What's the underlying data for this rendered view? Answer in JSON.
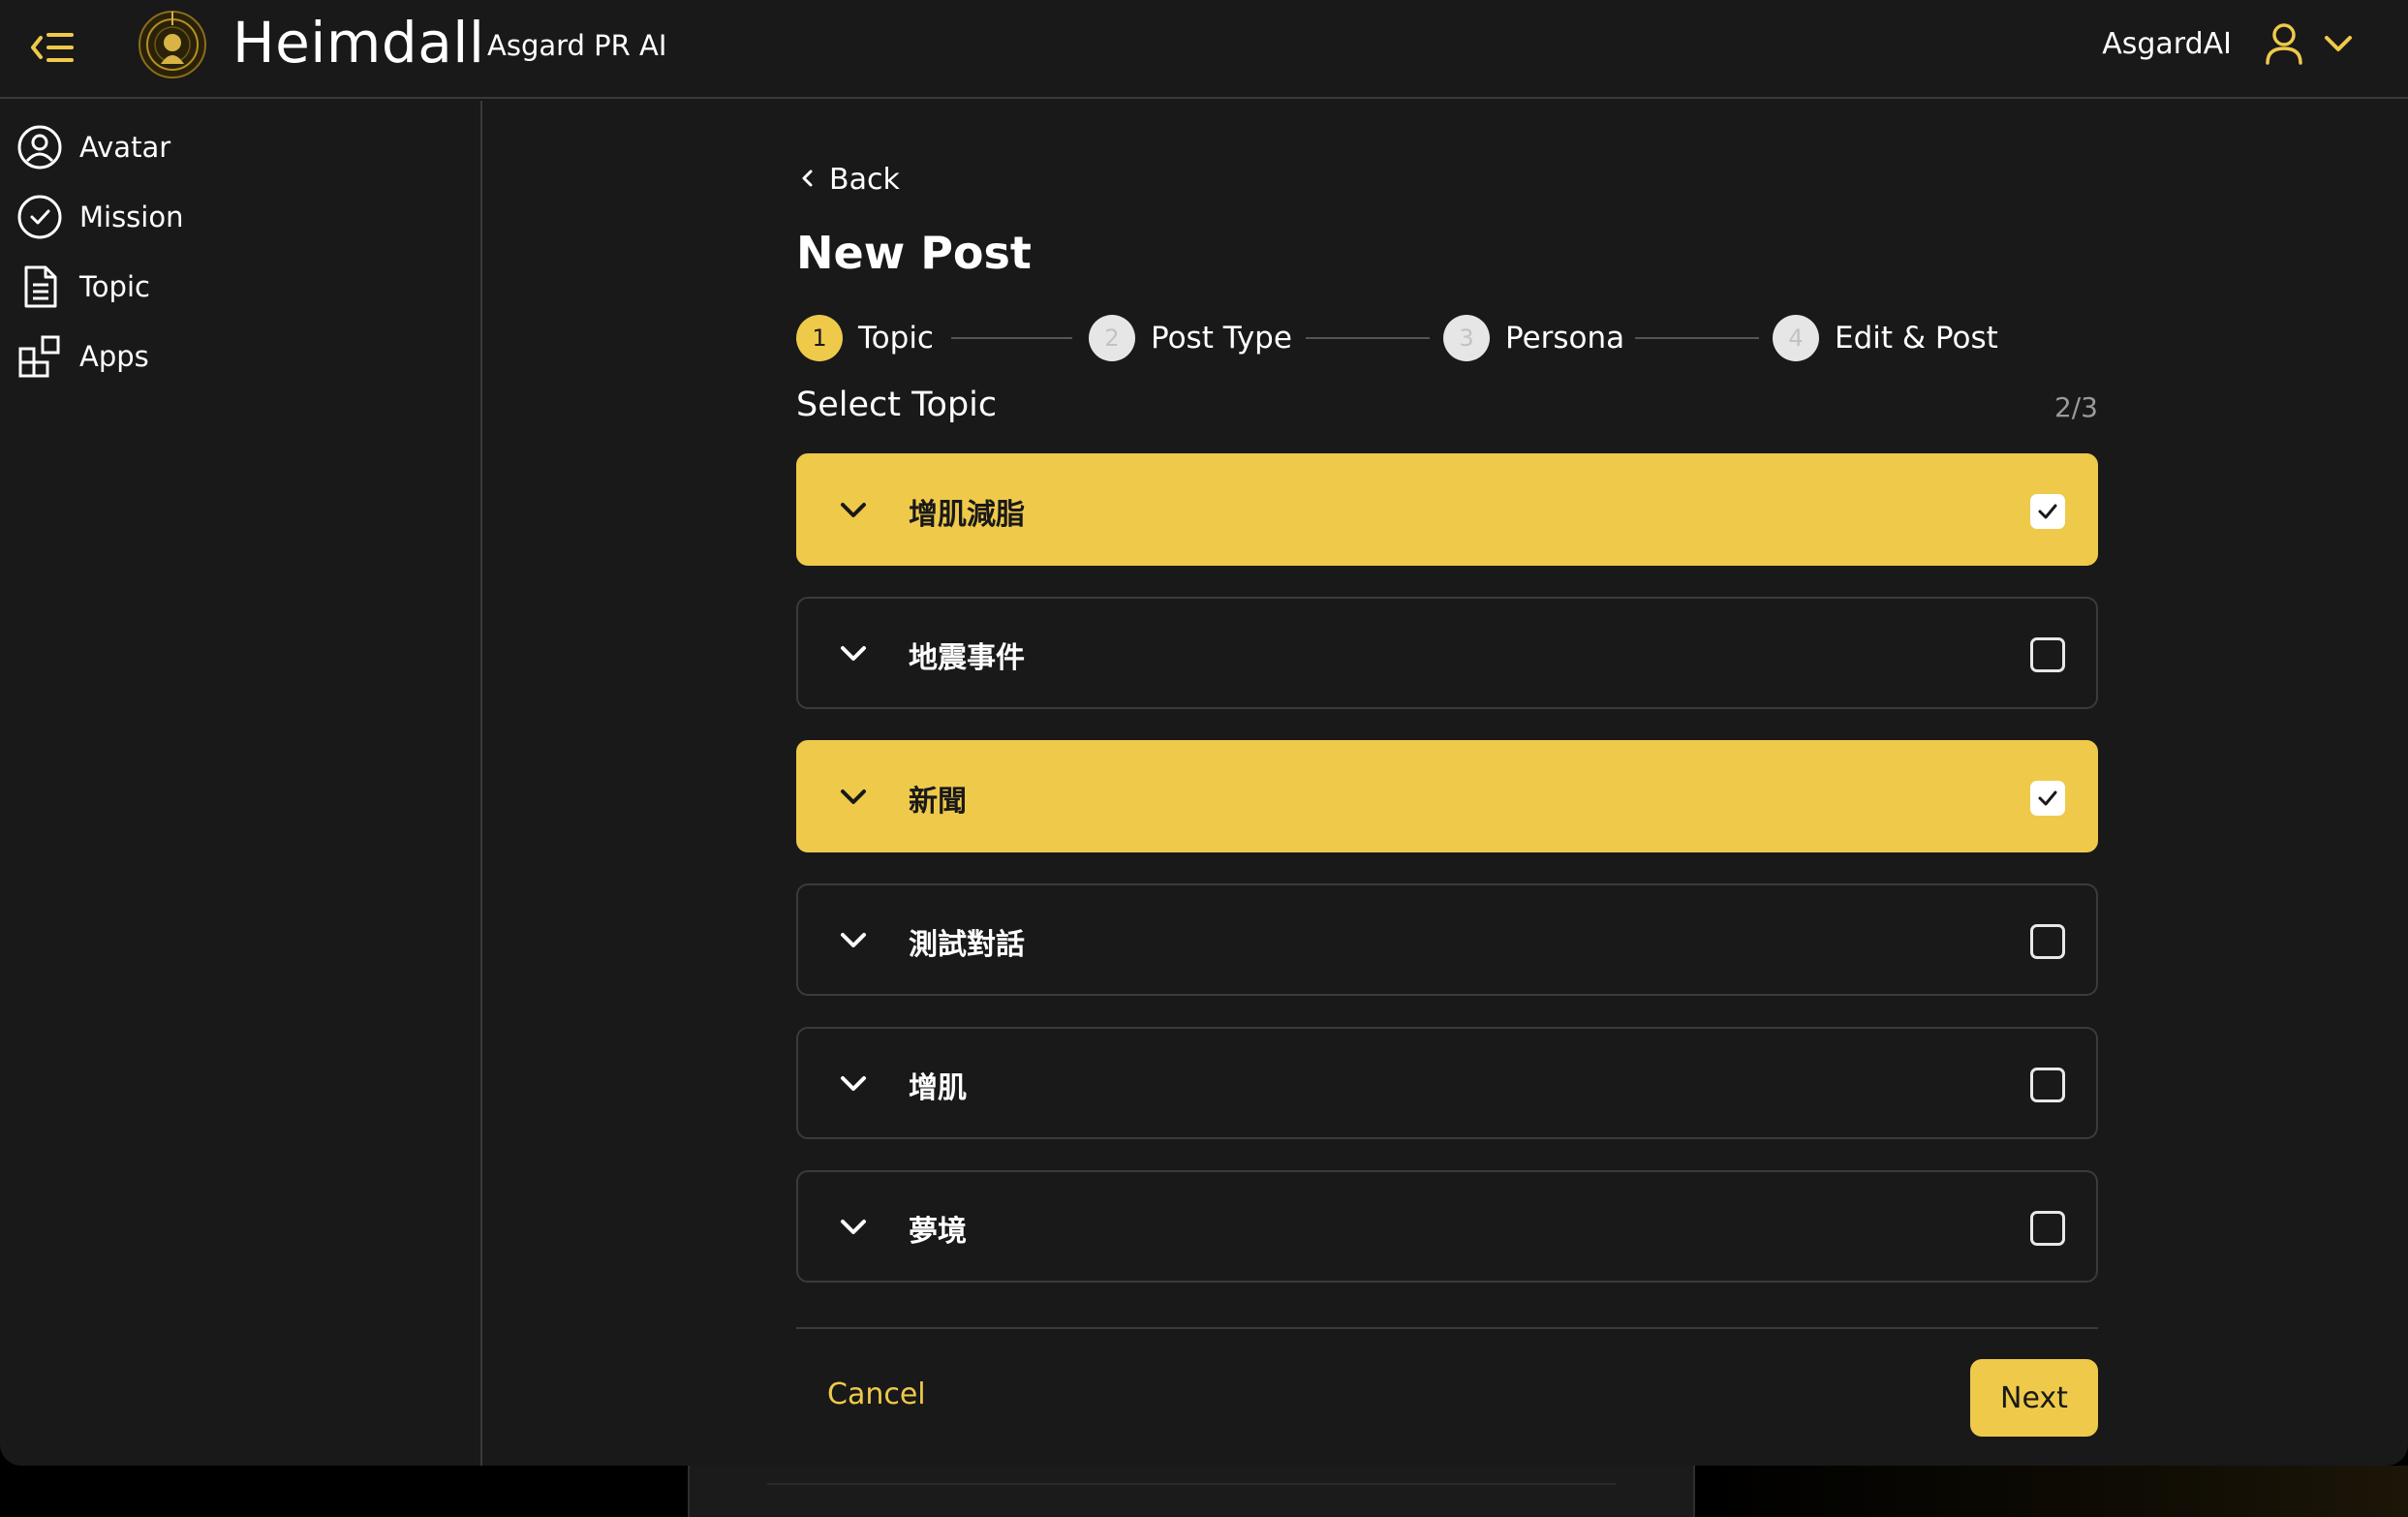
{
  "header": {
    "brand": "Heimdall",
    "subtitle": "Asgard PR AI",
    "user_name": "AsgardAI",
    "icons": {
      "menu": "menu-collapse-icon",
      "logo": "heimdall-logo",
      "user": "user-icon",
      "dropdown": "chevron-down-icon"
    }
  },
  "sidebar": {
    "items": [
      {
        "label": "Avatar",
        "icon": "user-circle-icon"
      },
      {
        "label": "Mission",
        "icon": "check-circle-icon"
      },
      {
        "label": "Topic",
        "icon": "document-icon"
      },
      {
        "label": "Apps",
        "icon": "apps-icon"
      }
    ]
  },
  "main": {
    "back_label": "Back",
    "title": "New Post",
    "steps": [
      {
        "number": "1",
        "label": "Topic",
        "state": "active"
      },
      {
        "number": "2",
        "label": "Post Type",
        "state": "inactive"
      },
      {
        "number": "3",
        "label": "Persona",
        "state": "inactive"
      },
      {
        "number": "4",
        "label": "Edit & Post",
        "state": "inactive"
      }
    ],
    "section_title": "Select Topic",
    "counter": "2/3",
    "topics": [
      {
        "name": "增肌減脂",
        "selected": true
      },
      {
        "name": "地震事件",
        "selected": false
      },
      {
        "name": "新聞",
        "selected": true
      },
      {
        "name": "測試對話",
        "selected": false
      },
      {
        "name": "增肌",
        "selected": false
      },
      {
        "name": "夢境",
        "selected": false
      }
    ],
    "cancel_label": "Cancel",
    "next_label": "Next"
  },
  "colors": {
    "accent": "#EFC94A",
    "background": "#191919",
    "border": "#3b3b3b",
    "text": "#ffffff"
  }
}
